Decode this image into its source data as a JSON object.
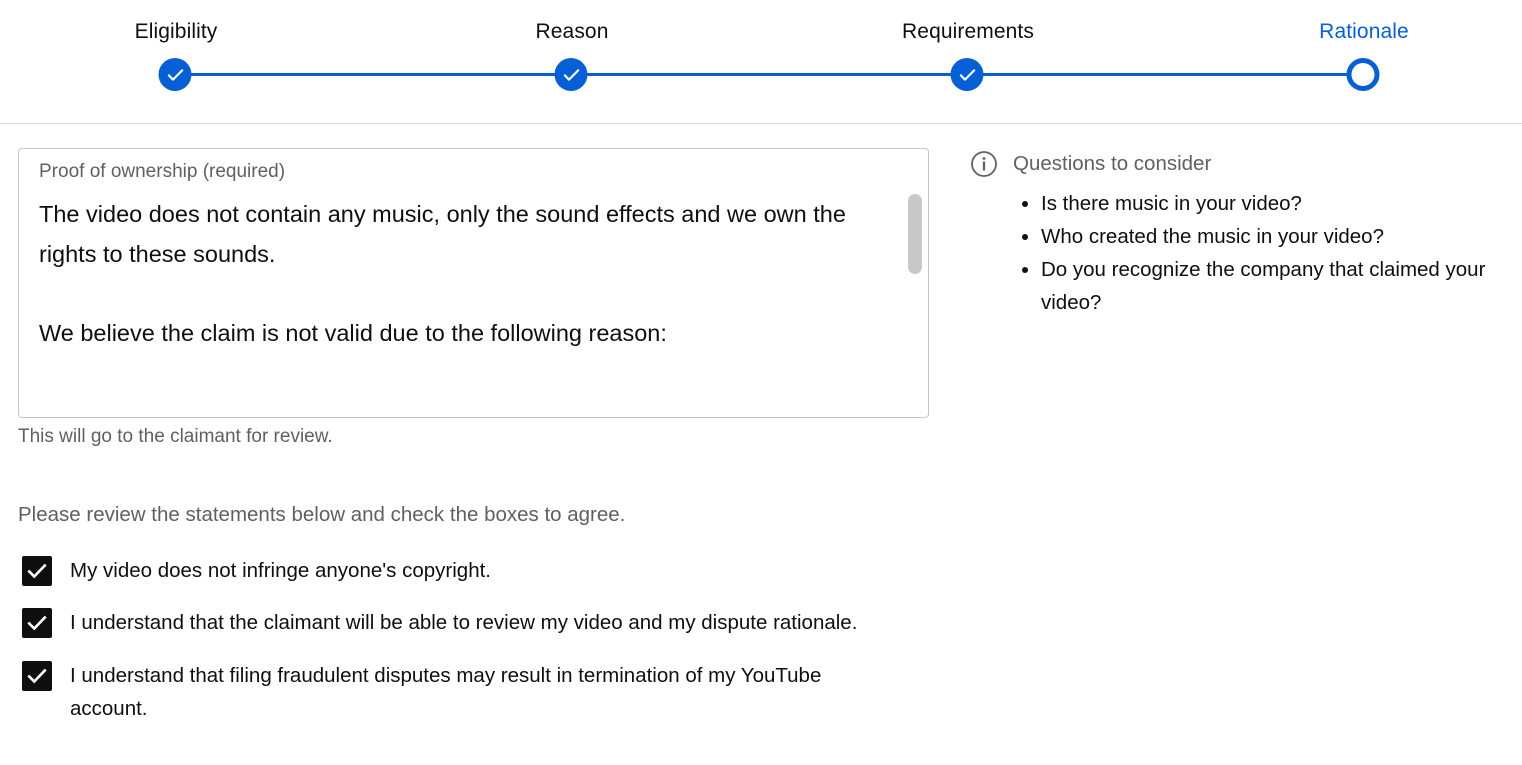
{
  "stepper": {
    "steps": [
      {
        "label": "Eligibility",
        "state": "done"
      },
      {
        "label": "Reason",
        "state": "done"
      },
      {
        "label": "Requirements",
        "state": "done"
      },
      {
        "label": "Rationale",
        "state": "current"
      }
    ],
    "accent_color": "#065fd4"
  },
  "proof": {
    "label": "Proof of ownership (required)",
    "value": "The video does not contain any music, only the sound effects and we own the rights to these sounds.\n\nWe believe the claim is not valid due to the following reason:",
    "helper": "This will go to the claimant for review."
  },
  "agreement": {
    "instructions": "Please review the statements below and check the boxes to agree.",
    "statements": [
      {
        "text": "My video does not infringe anyone's copyright.",
        "checked": true
      },
      {
        "text": "I understand that the claimant will be able to review my video and my dispute rationale.",
        "checked": true
      },
      {
        "text": "I understand that filing fraudulent disputes may result in termination of my YouTube account.",
        "checked": true
      }
    ]
  },
  "consider": {
    "icon": "info-icon",
    "title": "Questions to consider",
    "questions": [
      "Is there music in your video?",
      "Who created the music in your video?",
      "Do you recognize the company that claimed your video?"
    ]
  }
}
